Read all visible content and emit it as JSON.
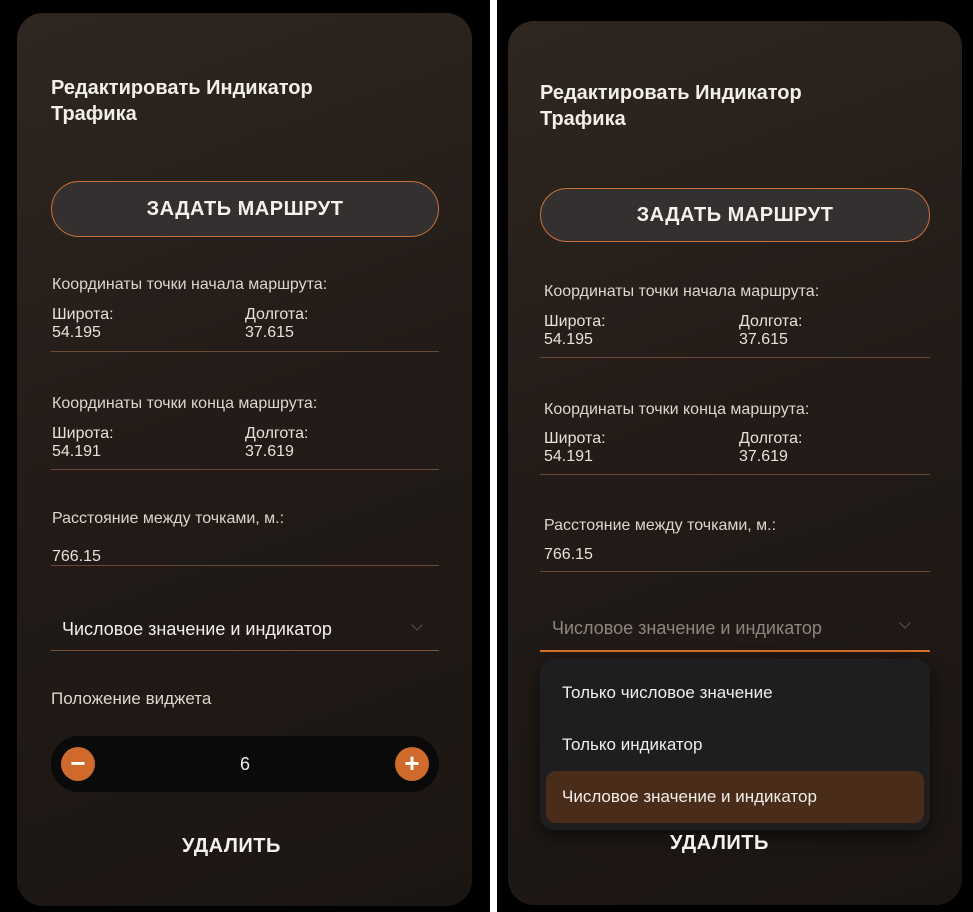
{
  "editor": {
    "title": "Редактировать Индикатор Трафика",
    "route_button": "ЗАДАТЬ МАРШРУТ",
    "start_coords": {
      "label": "Координаты точки начала маршрута:",
      "lat_label": "Широта:",
      "lat_value": "54.195",
      "lon_label": "Долгота:",
      "lon_value": "37.615"
    },
    "end_coords": {
      "label": "Координаты точки конца маршрута:",
      "lat_label": "Широта:",
      "lat_value": "54.191",
      "lon_label": "Долгота:",
      "lon_value": "37.619"
    },
    "distance": {
      "label": "Расстояние между точками, м.:",
      "value": "766.15"
    },
    "display_mode": {
      "selected": "Числовое значение и индикатор",
      "options": [
        "Только числовое значение",
        "Только индикатор",
        "Числовое значение и индикатор"
      ]
    },
    "widget_position": {
      "label": "Положение виджета",
      "value": "6",
      "minus": "−",
      "plus": "+"
    },
    "delete_button": "УДАЛИТЬ"
  },
  "colors": {
    "accent": "#cf6a2c",
    "panel": "#241d19",
    "selected_option": "#4a2c1b"
  },
  "icons": {
    "chevron": "chevron-down-icon",
    "minus": "minus-icon",
    "plus": "plus-icon"
  }
}
